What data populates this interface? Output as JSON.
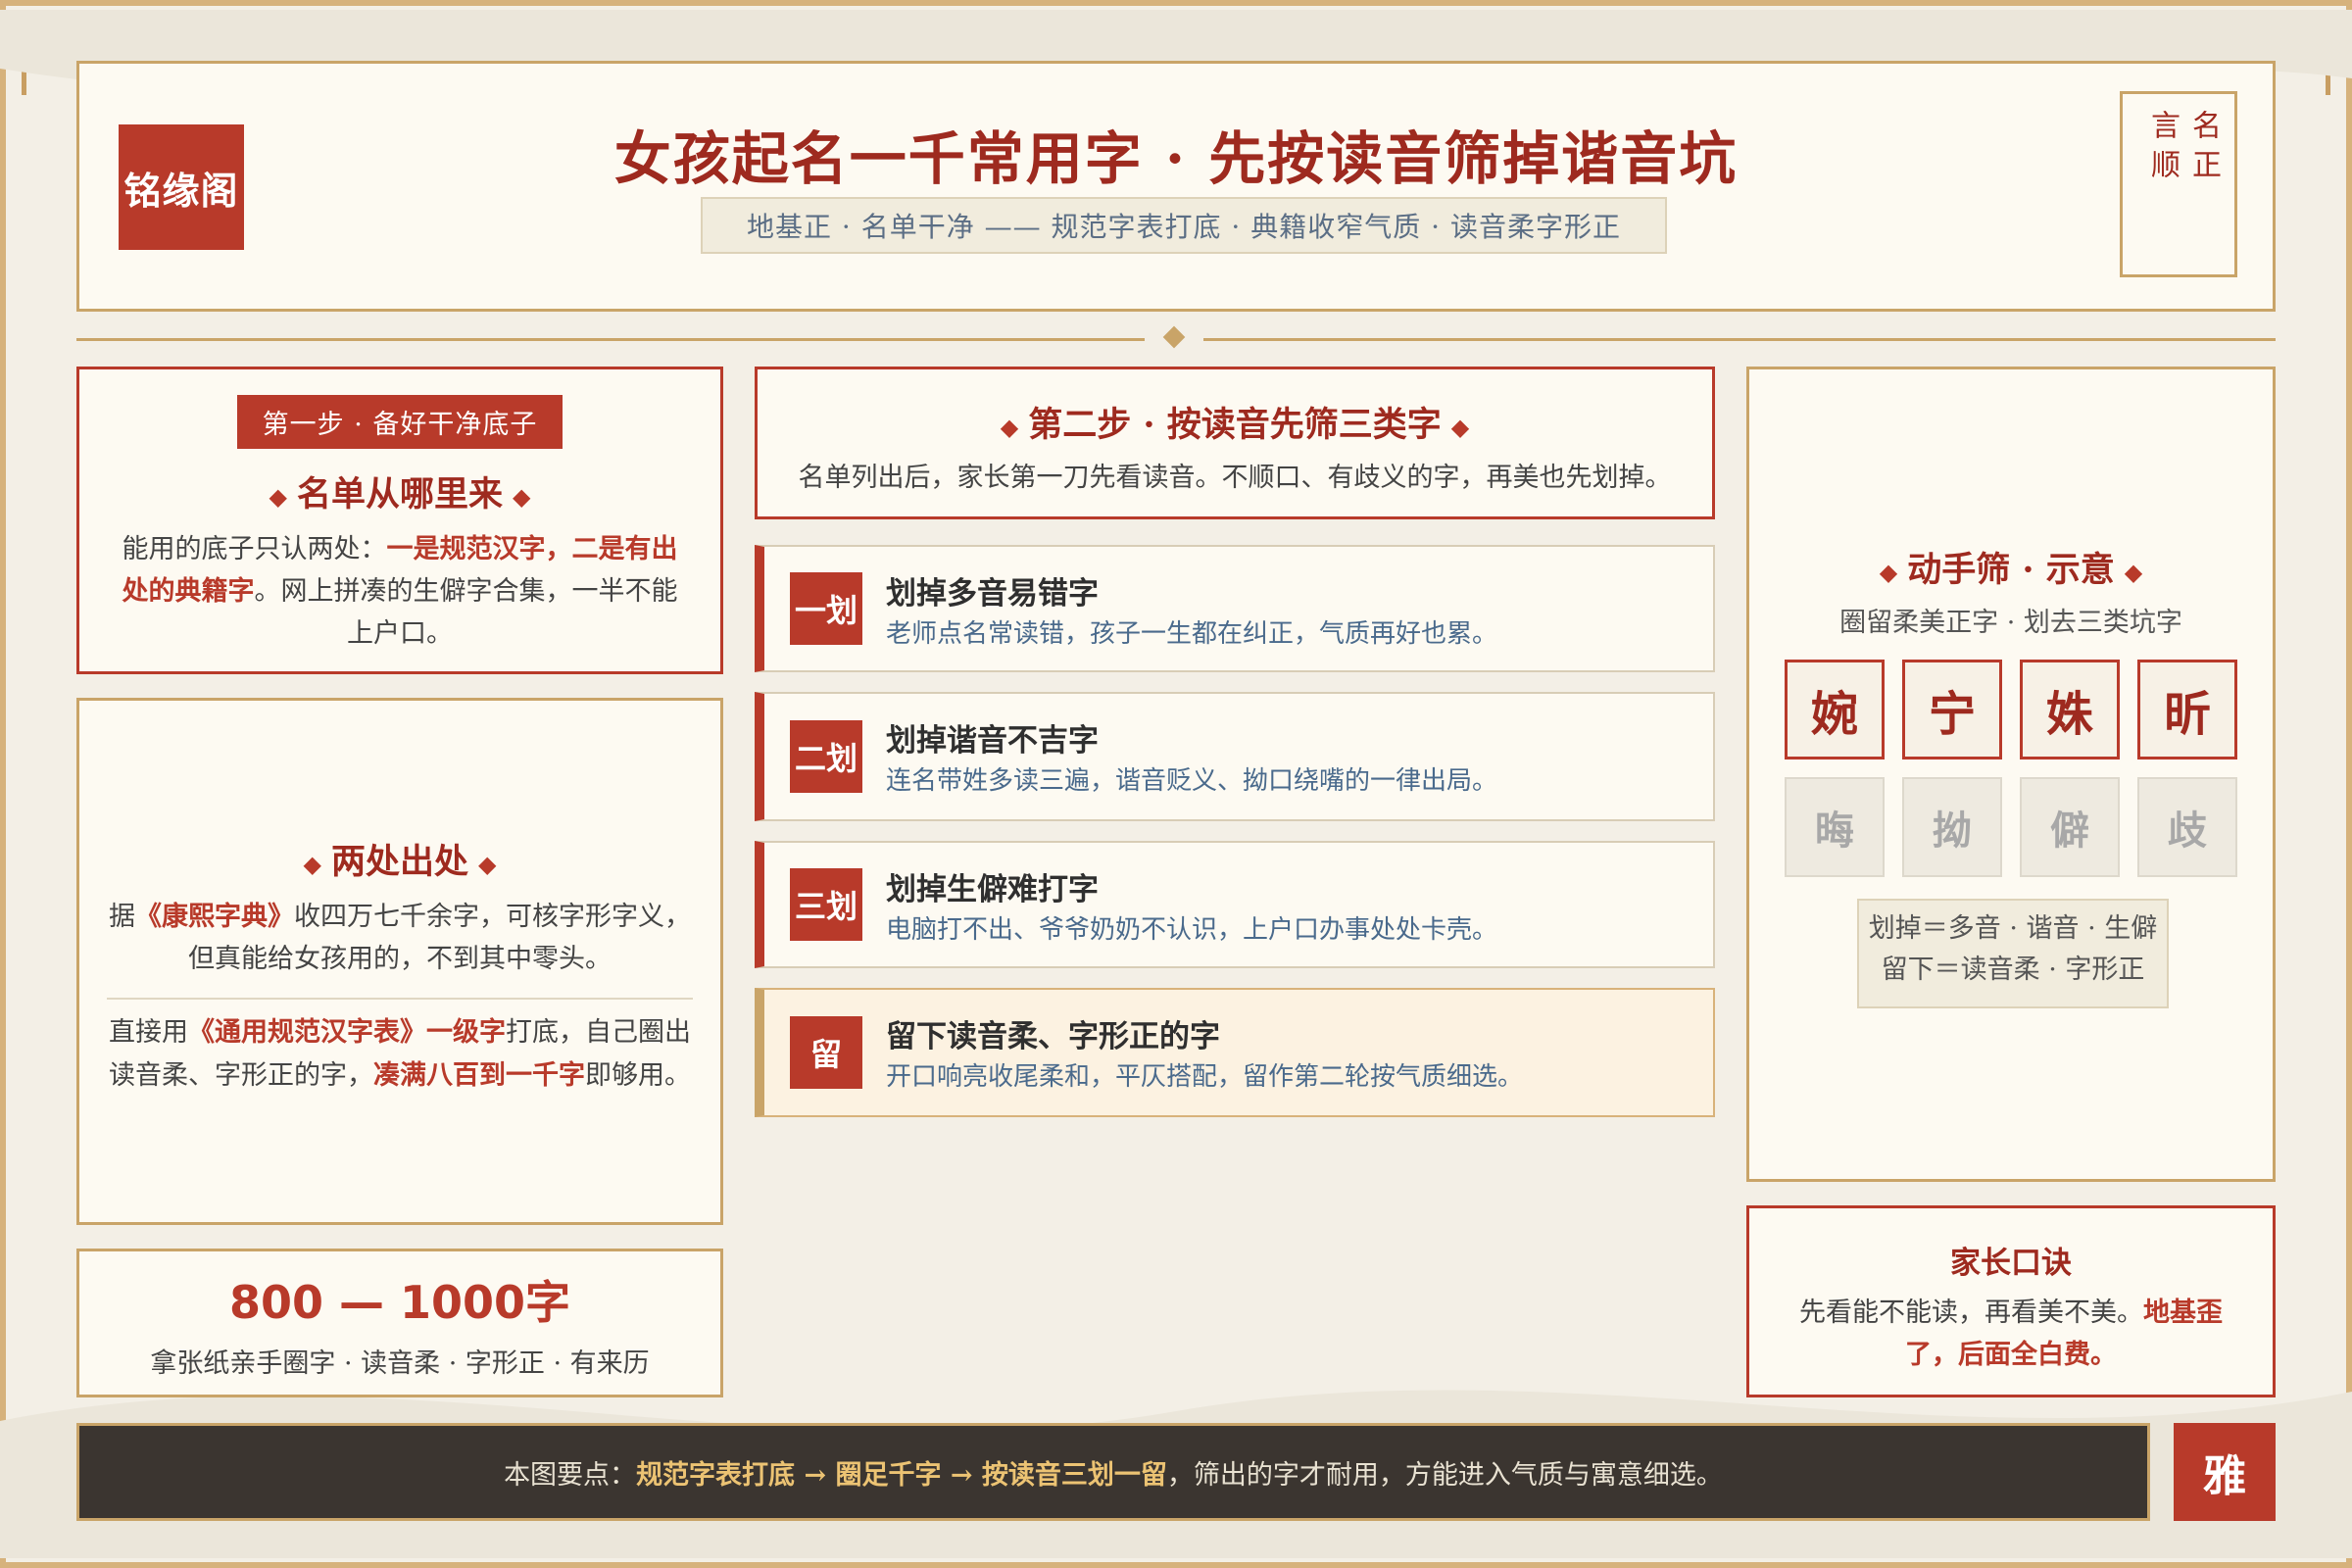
{
  "header": {
    "logo": "铭缘阁",
    "title": "女孩起名一千常用字 · 先按读音筛掉谐音坑",
    "subtitle": "地基正 · 名单干净 —— 规范字表打底 · 典籍收窄气质 · 读音柔字形正",
    "seal": [
      "名正",
      "言顺"
    ]
  },
  "step1": {
    "badge": "第一步 · 备好干净底子",
    "title": "名单从哪里来",
    "body_a": "能用的底子只认两处：",
    "body_em": "一是规范汉字，二是有出处的典籍字",
    "body_b": "。网上拼凑的生僻字合集，一半不能上户口。"
  },
  "sources": {
    "title": "两处出处",
    "p1_a": "据",
    "p1_em": "《康熙字典》",
    "p1_b": "收四万七千余字，可核字形字义，但真能给女孩用的，不到其中零头。",
    "p2_a": "直接用",
    "p2_em1": "《通用规范汉字表》一级字",
    "p2_b": "打底，自己圈出读音柔、字形正的字，",
    "p2_em2": "凑满八百到一千字",
    "p2_c": "即够用。"
  },
  "count": {
    "number": "800 — 1000字",
    "desc": "拿张纸亲手圈字 · 读音柔 · 字形正 · 有来历"
  },
  "step2": {
    "title": "第二步 · 按读音先筛三类字",
    "desc": "名单列出后，家长第一刀先看读音。不顺口、有歧义的字，再美也先划掉。"
  },
  "strikes": [
    {
      "tag": "一划",
      "title": "划掉多音易错字",
      "desc": "老师点名常读错，孩子一生都在纠正，气质再好也累。"
    },
    {
      "tag": "二划",
      "title": "划掉谐音不吉字",
      "desc": "连名带姓多读三遍，谐音贬义、拗口绕嘴的一律出局。"
    },
    {
      "tag": "三划",
      "title": "划掉生僻难打字",
      "desc": "电脑打不出、爷爷奶奶不认识，上户口办事处处卡壳。"
    },
    {
      "tag": "留",
      "title": "留下读音柔、字形正的字",
      "desc": "开口响亮收尾柔和，平仄搭配，留作第二轮按气质细选。"
    }
  ],
  "demo": {
    "title": "动手筛 · 示意",
    "subtitle": "圈留柔美正字 · 划去三类坑字",
    "keep": [
      "婉",
      "宁",
      "姝",
      "昕"
    ],
    "drop": [
      "晦",
      "拗",
      "僻",
      "歧"
    ],
    "rule1": "划掉＝多音 · 谐音 · 生僻",
    "rule2": "留下＝读音柔 · 字形正"
  },
  "motto": {
    "title": "家长口诀",
    "body": "先看能不能读，再看美不美。",
    "em": "地基歪了，后面全白费。"
  },
  "bottom": {
    "prefix": "本图要点：",
    "hl": "规范字表打底 → 圈足千字 → 按读音三划一留",
    "suffix": "，筛出的字才耐用，方能进入气质与寓意细选。",
    "stamp": "雅"
  }
}
